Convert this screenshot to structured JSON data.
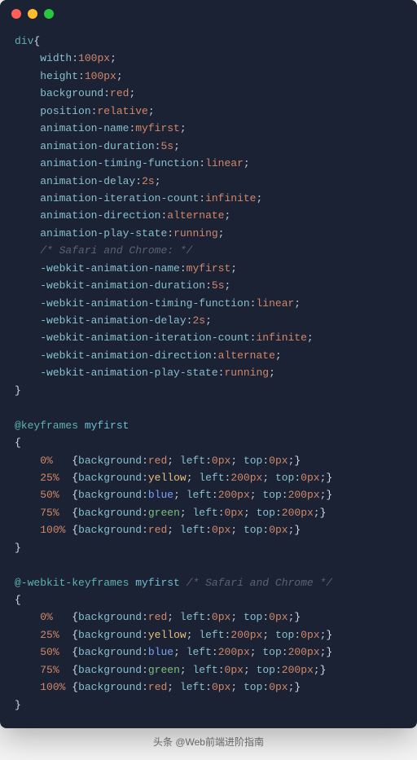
{
  "colors": {
    "bg": "#1a2233",
    "dot_red": "#ff5f56",
    "dot_yellow": "#ffbd2e",
    "dot_green": "#27c93f"
  },
  "code": {
    "selector": "div",
    "open_brace": "{",
    "close_brace": "}",
    "semicolon": ";",
    "colon": ":",
    "indent": "    ",
    "decls": [
      {
        "prop": "width",
        "value": "100",
        "unit": "px"
      },
      {
        "prop": "height",
        "value": "100",
        "unit": "px"
      },
      {
        "prop": "background",
        "value": "red",
        "cls": "c-val-red"
      },
      {
        "prop": "position",
        "value": "relative",
        "cls": "c-val-plain"
      },
      {
        "prop": "animation-name",
        "value": "myfirst",
        "cls": "c-val-plain"
      },
      {
        "prop": "animation-duration",
        "value": "5",
        "unit": "s"
      },
      {
        "prop": "animation-timing-function",
        "value": "linear",
        "cls": "c-val-plain"
      },
      {
        "prop": "animation-delay",
        "value": "2",
        "unit": "s"
      },
      {
        "prop": "animation-iteration-count",
        "value": "infinite",
        "cls": "c-val-plain"
      },
      {
        "prop": "animation-direction",
        "value": "alternate",
        "cls": "c-val-plain"
      },
      {
        "prop": "animation-play-state",
        "value": "running",
        "cls": "c-val-plain"
      }
    ],
    "comment1": "/* Safari and Chrome: */",
    "webkit_decls": [
      {
        "prop": "-webkit-animation-name",
        "value": "myfirst",
        "cls": "c-val-plain"
      },
      {
        "prop": "-webkit-animation-duration",
        "value": "5",
        "unit": "s"
      },
      {
        "prop": "-webkit-animation-timing-function",
        "value": "linear",
        "cls": "c-val-plain"
      },
      {
        "prop": "-webkit-animation-delay",
        "value": "2",
        "unit": "s"
      },
      {
        "prop": "-webkit-animation-iteration-count",
        "value": "infinite",
        "cls": "c-val-plain"
      },
      {
        "prop": "-webkit-animation-direction",
        "value": "alternate",
        "cls": "c-val-plain"
      },
      {
        "prop": "-webkit-animation-play-state",
        "value": "running",
        "cls": "c-val-plain"
      }
    ],
    "kf1": {
      "atrule": "@keyframes",
      "name": "myfirst",
      "frames": [
        {
          "pct": "0%",
          "pad": "   ",
          "bg": "red",
          "bgcls": "c-val-red",
          "left": "0",
          "top": "0"
        },
        {
          "pct": "25%",
          "pad": "  ",
          "bg": "yellow",
          "bgcls": "c-val-yellow",
          "left": "200",
          "top": "0"
        },
        {
          "pct": "50%",
          "pad": "  ",
          "bg": "blue",
          "bgcls": "c-val-blue",
          "left": "200",
          "top": "200"
        },
        {
          "pct": "75%",
          "pad": "  ",
          "bg": "green",
          "bgcls": "c-val-green",
          "left": "0",
          "top": "200"
        },
        {
          "pct": "100%",
          "pad": " ",
          "bg": "red",
          "bgcls": "c-val-red",
          "left": "0",
          "top": "0"
        }
      ]
    },
    "kf2": {
      "atrule": "@-webkit-keyframes",
      "name": "myfirst",
      "comment": "/* Safari and Chrome */",
      "frames": [
        {
          "pct": "0%",
          "pad": "   ",
          "bg": "red",
          "bgcls": "c-val-red",
          "left": "0",
          "top": "0"
        },
        {
          "pct": "25%",
          "pad": "  ",
          "bg": "yellow",
          "bgcls": "c-val-yellow",
          "left": "200",
          "top": "0"
        },
        {
          "pct": "50%",
          "pad": "  ",
          "bg": "blue",
          "bgcls": "c-val-blue",
          "left": "200",
          "top": "200"
        },
        {
          "pct": "75%",
          "pad": "  ",
          "bg": "green",
          "bgcls": "c-val-green",
          "left": "0",
          "top": "200"
        },
        {
          "pct": "100%",
          "pad": " ",
          "bg": "red",
          "bgcls": "c-val-red",
          "left": "0",
          "top": "0"
        }
      ]
    }
  },
  "footer": "头条 @Web前端进阶指南"
}
